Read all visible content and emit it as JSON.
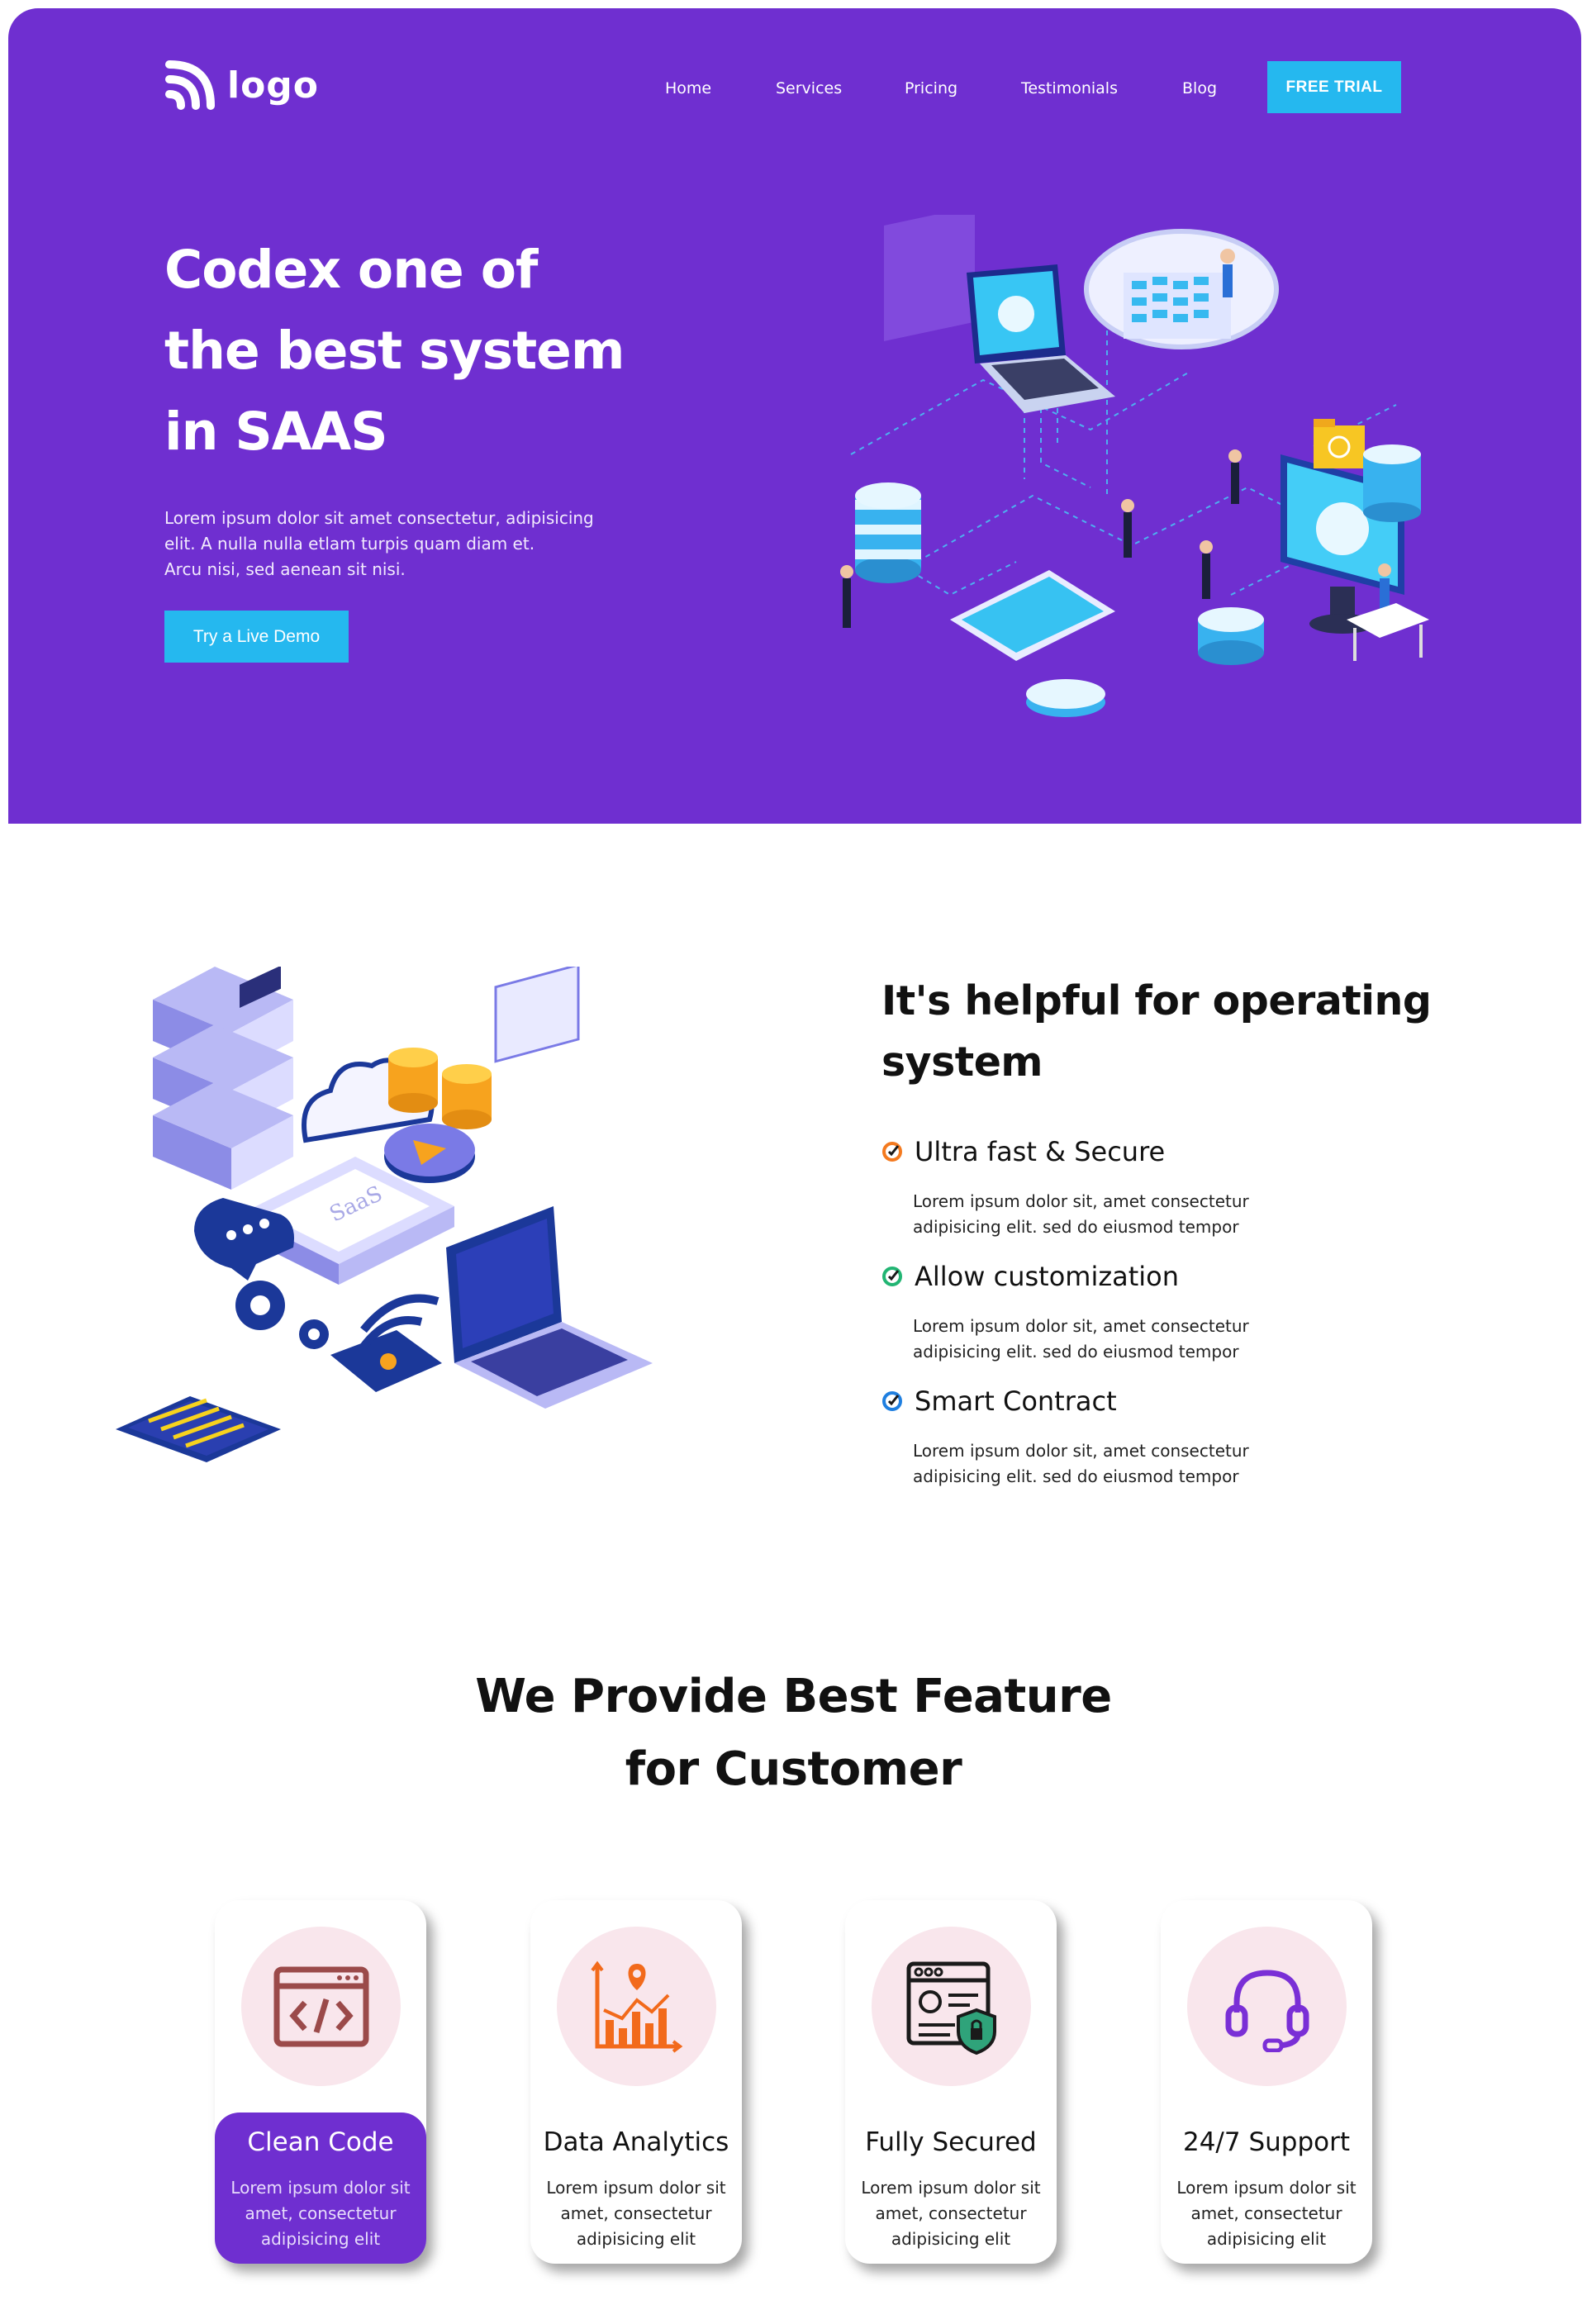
{
  "brand": {
    "logo_text": "logo"
  },
  "nav": {
    "links": [
      "Home",
      "Services",
      "Pricing",
      "Testimonials",
      "Blog"
    ],
    "cta": "FREE TRIAL"
  },
  "hero": {
    "title_lines": [
      "Codex one of",
      "the best system",
      "in SAAS"
    ],
    "description_lines": [
      "Lorem ipsum dolor sit amet consectetur, adipisicing",
      "elit. A nulla nulla etlam turpis quam diam et.",
      "Arcu nisi, sed aenean sit nisi."
    ],
    "cta": "Try a Live Demo"
  },
  "about": {
    "title_lines": [
      "It's helpful for operating",
      "system"
    ],
    "features": [
      {
        "title": "Ultra fast & Secure",
        "desc_lines": [
          "Lorem ipsum dolor sit, amet consectetur",
          "adipisicing elit. sed do eiusmod tempor"
        ],
        "icon": "check-circle-orange-icon",
        "color": "#f47a1f"
      },
      {
        "title": "Allow customization",
        "desc_lines": [
          "Lorem ipsum dolor sit, amet consectetur",
          "adipisicing elit. sed do eiusmod tempor"
        ],
        "icon": "check-circle-green-icon",
        "color": "#22b573"
      },
      {
        "title": "Smart Contract",
        "desc_lines": [
          "Lorem ipsum dolor sit, amet consectetur",
          "adipisicing elit. sed do eiusmod tempor"
        ],
        "icon": "check-circle-blue-icon",
        "color": "#1f7fe0"
      }
    ]
  },
  "features_section": {
    "title_lines": [
      "We Provide Best Feature",
      "for Customer"
    ],
    "cards": [
      {
        "title": "Clean Code",
        "text_lines": [
          "Lorem ipsum dolor sit",
          "amet, consectetur",
          "adipisicing elit"
        ],
        "icon": "code-window-icon",
        "active": true
      },
      {
        "title": "Data Analytics",
        "text_lines": [
          "Lorem ipsum dolor sit",
          "amet, consectetur",
          "adipisicing elit"
        ],
        "icon": "bar-chart-icon",
        "active": false
      },
      {
        "title": "Fully Secured",
        "text_lines": [
          "Lorem ipsum dolor sit",
          "amet, consectetur",
          "adipisicing elit"
        ],
        "icon": "secure-profile-icon",
        "active": false
      },
      {
        "title": "24/7 Support",
        "text_lines": [
          "Lorem ipsum dolor sit",
          "amet, consectetur",
          "adipisicing elit"
        ],
        "icon": "headset-icon",
        "active": false
      }
    ]
  },
  "colors": {
    "brand_purple": "#6f2fd0",
    "accent_blue": "#25b8ef",
    "card_circle": "#f9e6ec"
  }
}
